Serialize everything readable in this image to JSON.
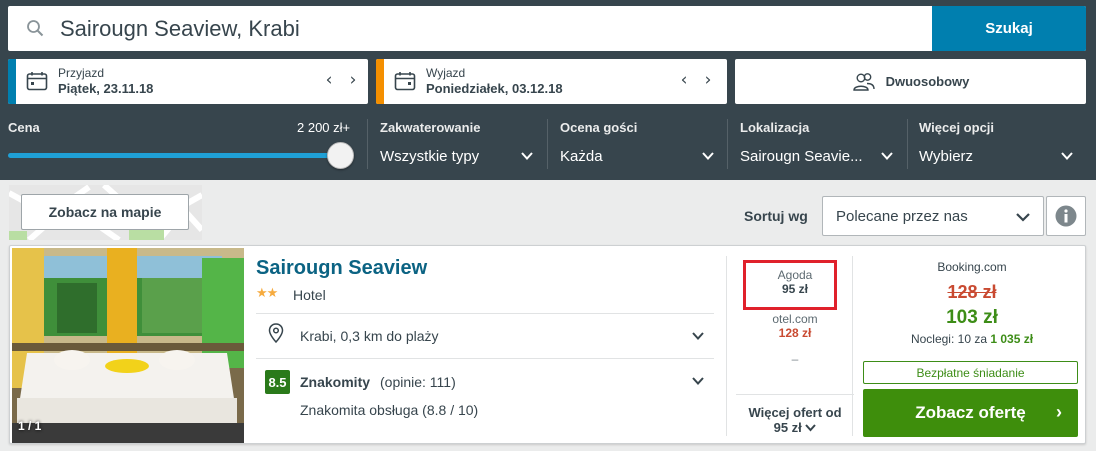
{
  "search": {
    "value": "Sairougn Seaview, Krabi",
    "button_label": "Szukaj",
    "icon": "search-icon"
  },
  "checkin": {
    "label": "Przyjazd",
    "value": "Piątek, 23.11.18",
    "accent_color": "#007faf"
  },
  "checkout": {
    "label": "Wyjazd",
    "value": "Poniedziałek, 03.12.18",
    "accent_color": "#f48f00"
  },
  "room": {
    "label": "Dwuosobowy",
    "icon": "guests-icon"
  },
  "filters": {
    "price": {
      "label": "Cena",
      "max_label": "2 200 zł+",
      "level_percent": 100
    },
    "accommodation": {
      "label": "Zakwaterowanie",
      "value": "Wszystkie typy"
    },
    "guest_rating": {
      "label": "Ocena gości",
      "value": "Każda"
    },
    "location": {
      "label": "Lokalizacja",
      "value": "Sairougn Seavie..."
    },
    "more": {
      "label": "Więcej opcji",
      "value": "Wybierz"
    }
  },
  "map": {
    "button_label": "Zobacz na mapie"
  },
  "sort": {
    "label": "Sortuj wg",
    "value": "Polecane przez nas"
  },
  "hotel": {
    "name": "Sairougn Seaview",
    "stars": "★★",
    "star_count": 2,
    "type": "Hotel",
    "photo_counter": "1 / 1",
    "location": "Krabi, 0,3 km do plaży",
    "rating_score": "8.5",
    "rating_word": "Znakomity",
    "rating_count": "(opinie: 111)",
    "rating_detail": "Znakomita obsługa (8.8 / 10)",
    "rating_color": "#2a7a1a"
  },
  "offers": {
    "items": [
      {
        "site": "Agoda",
        "price": "95 zł"
      },
      {
        "site": "otel.com",
        "price": "128 zł"
      },
      {
        "site": "",
        "price": "–"
      }
    ],
    "more_label": "Więcej ofert od",
    "more_price": "95 zł"
  },
  "best_offer": {
    "site": "Booking.com",
    "old_price": "128 zł",
    "price": "103 zł",
    "nights_prefix": "Noclegi: 10 za",
    "nights_total": "1 035 zł",
    "badge": "Bezpłatne śniadanie",
    "button_label": "Zobacz ofertę",
    "button_color": "#3e8e0c"
  }
}
